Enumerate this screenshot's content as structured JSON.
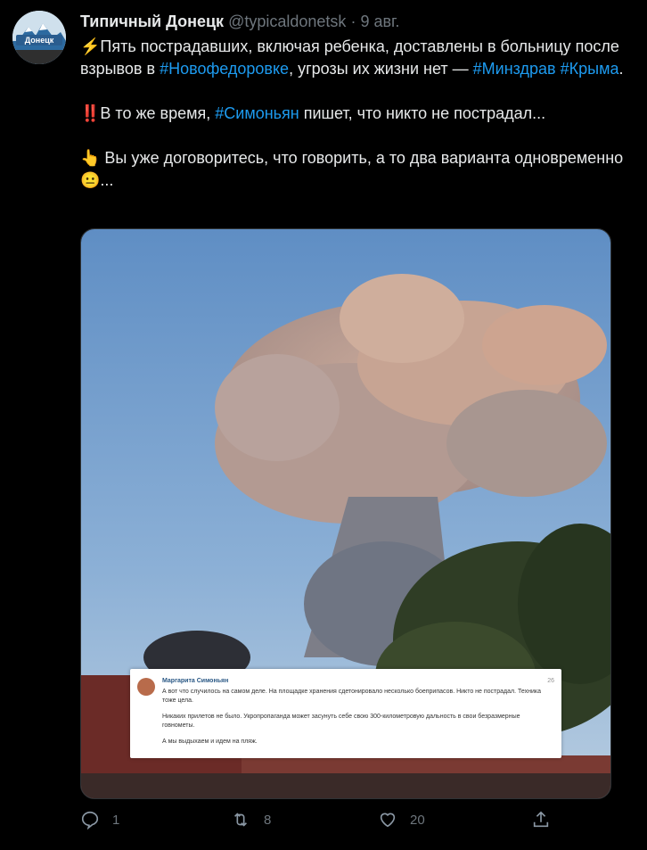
{
  "tweet": {
    "name": "Типичный Донецк",
    "handle": "@typicaldonetsk",
    "separator": "·",
    "date": "9 авг.",
    "avatar_text": "Донецк",
    "lines": {
      "p1_emoji": "⚡",
      "p1_a": "Пять пострадавших, включая ребенка, доставлены в больницу после взрывов в ",
      "p1_tag1": "#Новофедоровке",
      "p1_b": ", угрозы их жизни нет — ",
      "p1_tag2": "#Минздрав",
      "p1_tag3": "#Крыма",
      "p1_end": ".",
      "p2_emoji": "‼️",
      "p2_a": "В то же время, ",
      "p2_tag": "#Симоньян",
      "p2_b": " пишет, что никто не пострадал...",
      "p3_emoji": "👆",
      "p3_a": " Вы уже договоритесь, что говорить, а то два варианта одновременно ",
      "p3_emoji2": "😐",
      "p3_end": "..."
    }
  },
  "embedded_post": {
    "author": "Маргарита Симоньян",
    "date": "26",
    "text1": "А вот что случилось на самом деле. На площадке хранения сдетонировало несколько боеприпасов. Никто не пострадал. Техника тоже цела.",
    "text2": "Никаких прилетов не было. Укропропаганда может засунуть себе свою 300-километровую дальность в свои безразмерные говнометы.",
    "text3": "А мы выдыхаем и идем на пляж."
  },
  "actions": {
    "reply_count": "1",
    "retweet_count": "8",
    "like_count": "20",
    "icons": [
      "reply-icon",
      "retweet-icon",
      "like-icon",
      "share-icon"
    ]
  },
  "colors": {
    "background": "#000000",
    "link": "#1d9bf0",
    "text": "#e7e9ea",
    "muted": "#6e767d"
  }
}
